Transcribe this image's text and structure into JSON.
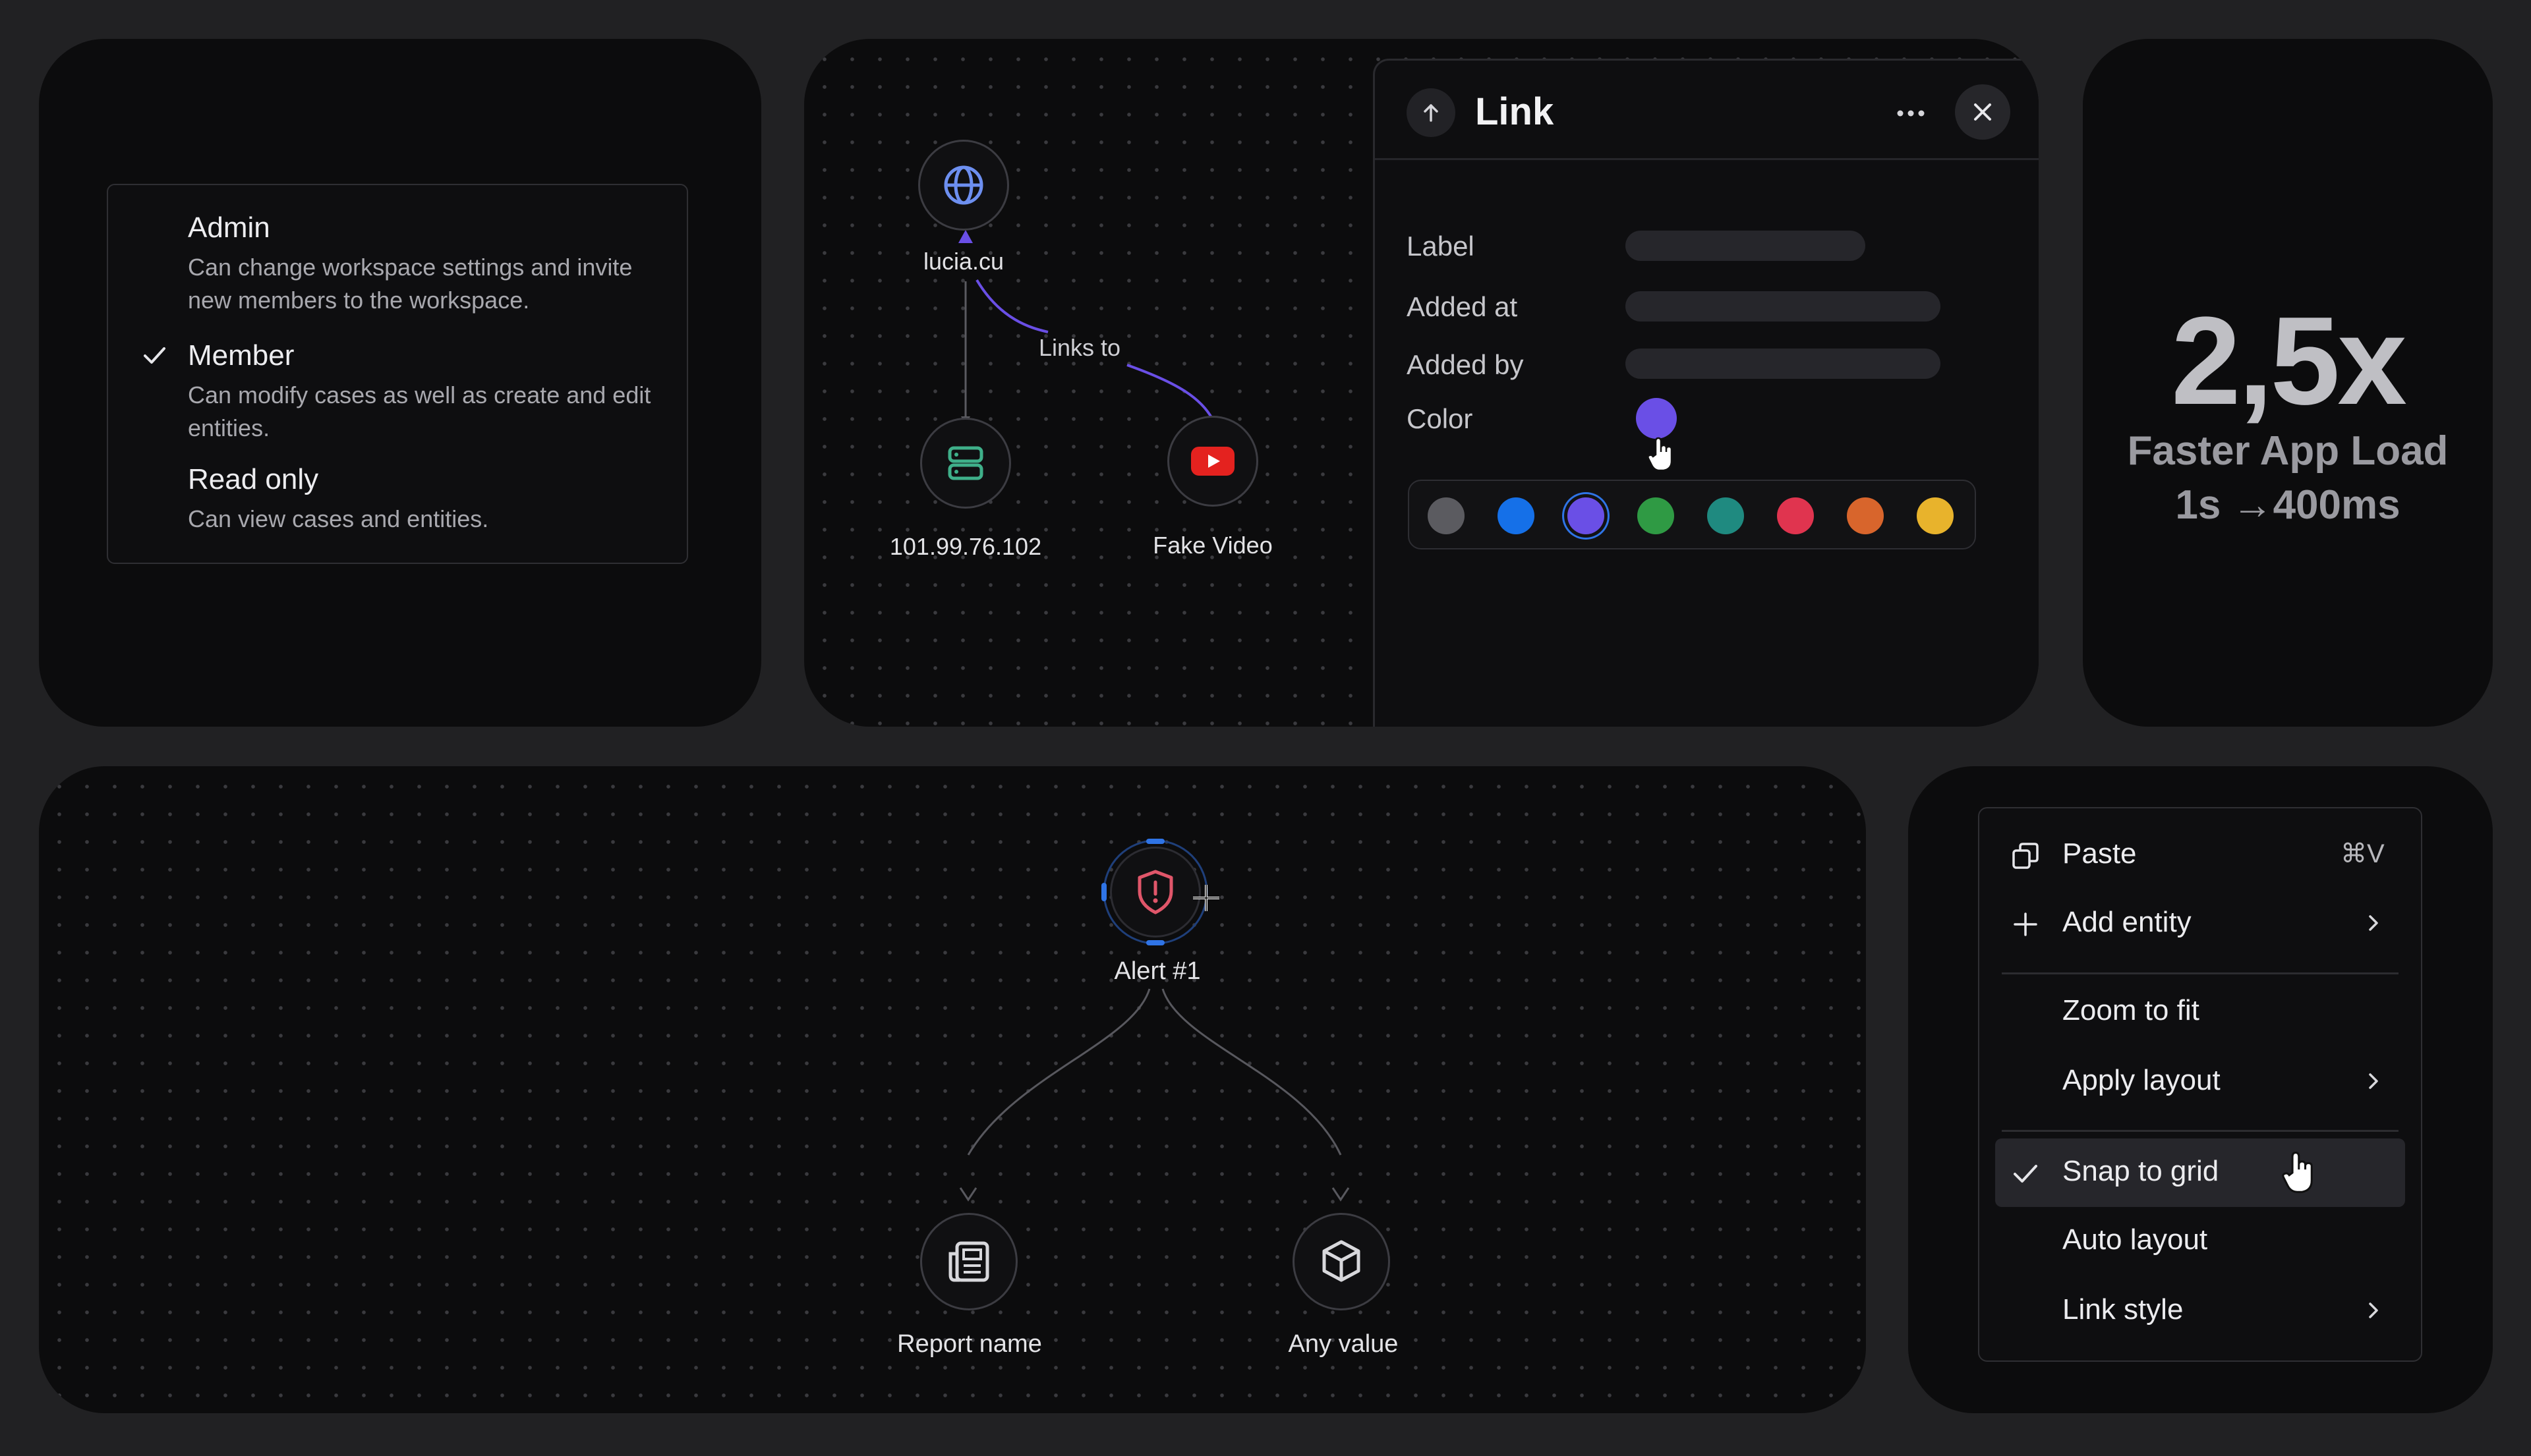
{
  "roles": {
    "items": [
      {
        "title": "Admin",
        "desc": "Can change workspace settings and invite new members to the workspace.",
        "checked": false
      },
      {
        "title": "Member",
        "desc": "Can modify cases as well as create and edit entities.",
        "checked": true
      },
      {
        "title": "Read only",
        "desc": "Can view cases and entities.",
        "checked": false
      }
    ]
  },
  "graph": {
    "nodes": {
      "domain": "lucia.cu",
      "ip": "101.99.76.102",
      "video": "Fake Video"
    },
    "edge_label": "Links to",
    "edge_color": "#6a4fe6"
  },
  "link_panel": {
    "title": "Link",
    "fields": {
      "label": "Label",
      "added_at": "Added at",
      "added_by": "Added by",
      "color": "Color"
    },
    "selected_color": "#6a4fe6",
    "swatches": [
      "#5b5b60",
      "#1570e8",
      "#6a4fe6",
      "#2f9a44",
      "#1f8a80",
      "#e0344f",
      "#d8652c",
      "#e8b32c"
    ]
  },
  "stat": {
    "value": "2,5x",
    "caption": "Faster App Load",
    "detail": "1s →400ms"
  },
  "alert_graph": {
    "root": "Alert #1",
    "children": [
      "Report name",
      "Any value"
    ]
  },
  "context_menu": {
    "paste": {
      "label": "Paste",
      "shortcut": "⌘V"
    },
    "add_entity": "Add entity",
    "zoom_to_fit": "Zoom to fit",
    "apply_layout": "Apply layout",
    "snap_to_grid": "Snap to grid",
    "auto_layout": "Auto layout",
    "link_style": "Link style"
  },
  "colors": {
    "background": "#212123",
    "card": "#0c0c0d",
    "accent": "#6a4fe6",
    "alert_red": "#e0566a",
    "youtube_red": "#e4221f"
  }
}
